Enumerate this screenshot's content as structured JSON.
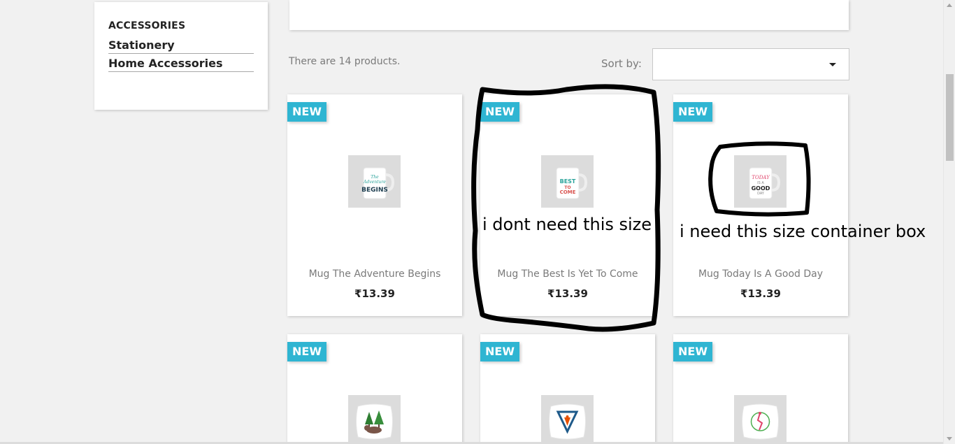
{
  "sidebar": {
    "title": "ACCESSORIES",
    "items": [
      {
        "label": "Stationery"
      },
      {
        "label": "Home Accessories"
      }
    ]
  },
  "listing": {
    "count_text": "There are 14 products.",
    "sort_label": "Sort by:",
    "sort_value": ""
  },
  "products": [
    {
      "badge": "NEW",
      "name": "Mug The Adventure Begins",
      "price": "₹13.39"
    },
    {
      "badge": "NEW",
      "name": "Mug The Best Is Yet To Come",
      "price": "₹13.39"
    },
    {
      "badge": "NEW",
      "name": "Mug Today Is A Good Day",
      "price": "₹13.39"
    },
    {
      "badge": "NEW",
      "name": "",
      "price": ""
    },
    {
      "badge": "NEW",
      "name": "",
      "price": ""
    },
    {
      "badge": "NEW",
      "name": "",
      "price": ""
    }
  ],
  "annotations": {
    "note_left": "i dont need this size",
    "note_right": "i need this size container box"
  },
  "colors": {
    "badge": "#2fb5d2",
    "background": "#f1f1f1",
    "card": "#ffffff",
    "ink": "#000000"
  },
  "icons": {
    "sort_caret": "caret-down-icon"
  },
  "mug_texts": {
    "mug1": [
      "The",
      "Adventure",
      "BEGINS"
    ],
    "mug2": [
      "BEST",
      "TO",
      "COME"
    ],
    "mug3": [
      "TODAY",
      "IS A",
      "GOOD",
      "DAY"
    ]
  }
}
